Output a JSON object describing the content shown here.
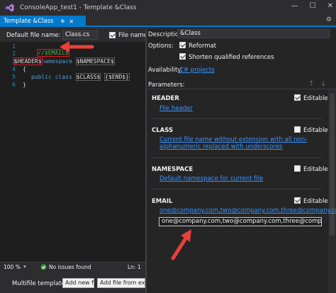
{
  "window": {
    "title": "ConsoleApp_test1 - Template &Class",
    "minimize": "—",
    "maximize": "☐",
    "close": "✕"
  },
  "tab": {
    "label": "Template &Class",
    "pin_glyph": "⊕",
    "close_glyph": "✕",
    "overflow_glyph": "⚙"
  },
  "left_header": {
    "file_name_label": "Default file name:",
    "file_name_value": "Class.cs",
    "file_name_must_label": "File name m",
    "file_name_must_checked": true
  },
  "editor": {
    "lines": [
      "1",
      "2",
      "3",
      "4",
      "5",
      "6"
    ],
    "line1": "//$EMAIL$",
    "line3_header": "$HEADER$",
    "line3_ns_kw": "namespace",
    "line3_ns_var": "$NAMESPACE$",
    "line4": "{",
    "line5_kw": "public class",
    "line5_class": "$CLASS$",
    "line5_end": "{$END$}",
    "line6": "}"
  },
  "status": {
    "zoom": "100 %",
    "issues": "No issues found",
    "position": "Ln: 1"
  },
  "bottom": {
    "multifile_label": "Multifile template:",
    "add_new_file": "Add new file",
    "add_file_from_existing": "Add file from existi"
  },
  "right": {
    "description_label": "Description:",
    "description_value": "&Class",
    "options_label": "Options:",
    "reformat_label": "Reformat",
    "reformat_checked": true,
    "shorten_label": "Shorten qualified references",
    "shorten_checked": true,
    "availability_label": "Availability:",
    "availability_link": "C# projects",
    "parameters_label": "Parameters:",
    "up_glyph": "↑",
    "down_glyph": "↓"
  },
  "parameters": [
    {
      "name": "HEADER",
      "editable_label": "Editable",
      "editable": true,
      "description": "File header"
    },
    {
      "name": "CLASS",
      "editable_label": "Editable",
      "editable": false,
      "description": "Current file name without extension with all non-alphanumeric replaced with underscores"
    },
    {
      "name": "NAMESPACE",
      "editable_label": "Editable",
      "editable": false,
      "description": "Default namespace for current file"
    },
    {
      "name": "EMAIL",
      "editable_label": "Editable",
      "editable": true,
      "description": "one@company.com,two@company.com,three@company.com",
      "value": "one@company.com,two@company.com,three@company.com"
    }
  ],
  "colors": {
    "accent": "#007acc",
    "annotation_arrow": "#e8403a",
    "link": "#3794ff"
  }
}
